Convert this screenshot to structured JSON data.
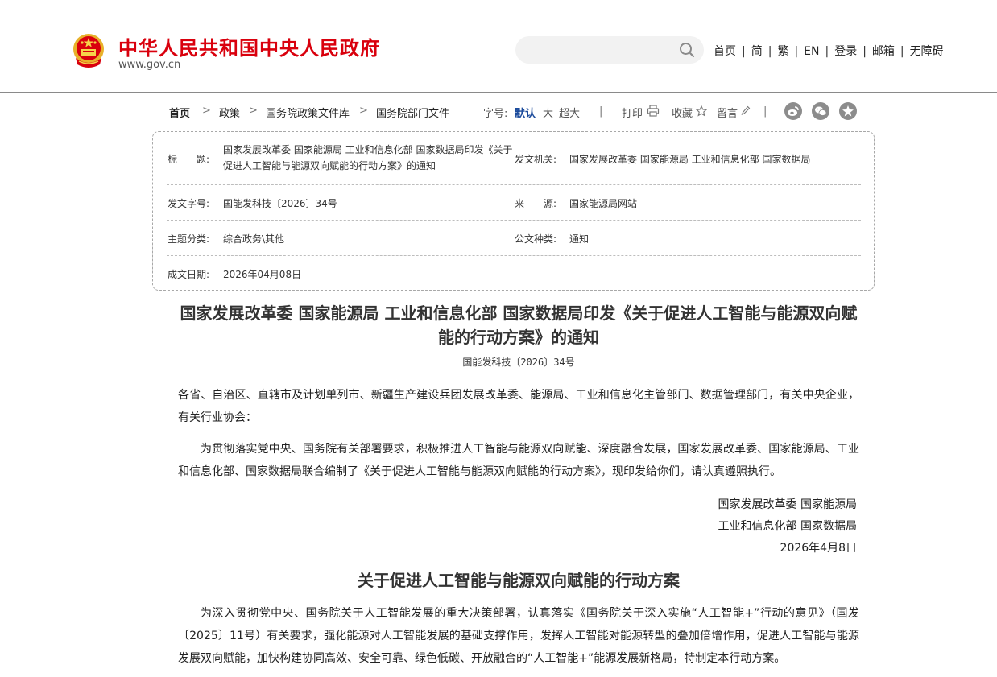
{
  "header": {
    "site_title": "中华人民共和国中央人民政府",
    "site_url": "www.gov.cn",
    "search_placeholder": "",
    "nav": [
      "首页",
      "简",
      "繁",
      "EN",
      "登录",
      "邮箱",
      "无障碍"
    ],
    "nav_sep": "|"
  },
  "breadcrumb": {
    "items": [
      "首页",
      "政策",
      "国务院政策文件库",
      "国务院部门文件"
    ],
    "arrow": ">"
  },
  "toolbar": {
    "font_label": "字号:",
    "font_sizes": [
      "默认",
      "大",
      "超大"
    ],
    "print": "打印",
    "favorite": "收藏",
    "comment": "留言",
    "sep": "|"
  },
  "colors": {
    "brand_red": "#d9000d",
    "active_blue": "#1c4b9c",
    "social_gray": "#8c8c8c"
  },
  "icons": [
    "national-emblem-icon",
    "search-icon",
    "print-icon",
    "star-icon",
    "pencil-icon",
    "weibo-icon",
    "wechat-icon",
    "qzone-icon"
  ],
  "info": {
    "title_label": "标　　题:",
    "title_value": "国家发展改革委 国家能源局 工业和信息化部 国家数据局印发《关于促进人工智能与能源双向赋能的行动方案》的通知",
    "issuer_label": "发文机关:",
    "issuer_value": "国家发展改革委 国家能源局 工业和信息化部 国家数据局",
    "docno_label": "发文字号:",
    "docno_value": "国能发科技〔2026〕34号",
    "source_label": "来　　源:",
    "source_value": "国家能源局网站",
    "topic_label": "主题分类:",
    "topic_value": "综合政务\\其他",
    "type_label": "公文种类:",
    "type_value": "通知",
    "date_label": "成文日期:",
    "date_value": "2026年04月08日"
  },
  "article": {
    "title": "国家发展改革委 国家能源局 工业和信息化部 国家数据局印发《关于促进人工智能与能源双向赋能的行动方案》的通知",
    "doc_number": "国能发科技〔2026〕34号",
    "addressee": "各省、自治区、直辖市及计划单列市、新疆生产建设兵团发展改革委、能源局、工业和信息化主管部门、数据管理部门，有关中央企业，有关行业协会：",
    "body": "为贯彻落实党中央、国务院有关部署要求，积极推进人工智能与能源双向赋能、深度融合发展，国家发展改革委、国家能源局、工业和信息化部、国家数据局联合编制了《关于促进人工智能与能源双向赋能的行动方案》，现印发给你们，请认真遵照执行。",
    "signature_1": "国家发展改革委 国家能源局",
    "signature_2": "工业和信息化部 国家数据局",
    "signature_date": "2026年4月8日",
    "plan_title": "关于促进人工智能与能源双向赋能的行动方案",
    "plan_intro": "为深入贯彻党中央、国务院关于人工智能发展的重大决策部署，认真落实《国务院关于深入实施“人工智能+”行动的意见》（国发〔2025〕11号）有关要求，强化能源对人工智能发展的基础支撑作用，发挥人工智能对能源转型的叠加倍增作用，促进人工智能与能源发展双向赋能，加快构建协同高效、安全可靠、绿色低碳、开放融合的“人工智能+”能源发展新格局，特制定本行动方案。"
  }
}
